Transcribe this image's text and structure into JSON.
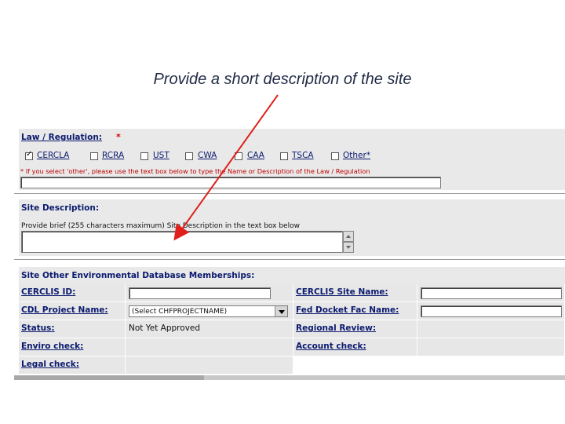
{
  "caption": "Provide a short description of the site",
  "law": {
    "title": "Law / Regulation:",
    "required_mark": "*",
    "options": [
      {
        "label": "CERCLA",
        "checked": true
      },
      {
        "label": "RCRA",
        "checked": false
      },
      {
        "label": "UST",
        "checked": false
      },
      {
        "label": "CWA",
        "checked": false
      },
      {
        "label": "CAA",
        "checked": false
      },
      {
        "label": "TSCA",
        "checked": false
      },
      {
        "label": "Other*",
        "checked": false
      }
    ],
    "note": "* If you select 'other', please use the text box below to type the Name or Description of the Law / Regulation",
    "other_value": ""
  },
  "site_description": {
    "title": "Site Description:",
    "instructions": "Provide brief (255 characters maximum) Site Description in the text box below",
    "value": ""
  },
  "memberships": {
    "title": "Site Other Environmental Database Memberships:",
    "rows": [
      {
        "left_label": "CERCLIS ID:",
        "left_value": "",
        "right_label": "CERCLIS Site Name:",
        "right_value": ""
      },
      {
        "left_label": "CDL Project Name:",
        "left_select": "(Select CHFPROJECTNAME)",
        "right_label": "Fed Docket Fac Name:",
        "right_value": ""
      },
      {
        "left_label": "Status:",
        "left_text": "Not Yet Approved",
        "right_label": "Regional Review:",
        "right_text": ""
      },
      {
        "left_label": "Enviro check:",
        "left_text": "",
        "right_label": "Account check:",
        "right_text": ""
      },
      {
        "left_label": "Legal check:",
        "left_text": ""
      }
    ]
  },
  "colors": {
    "accent_red": "#d40000",
    "label_blue": "#0b1a6e",
    "panel_gray": "#e9e9e9"
  }
}
